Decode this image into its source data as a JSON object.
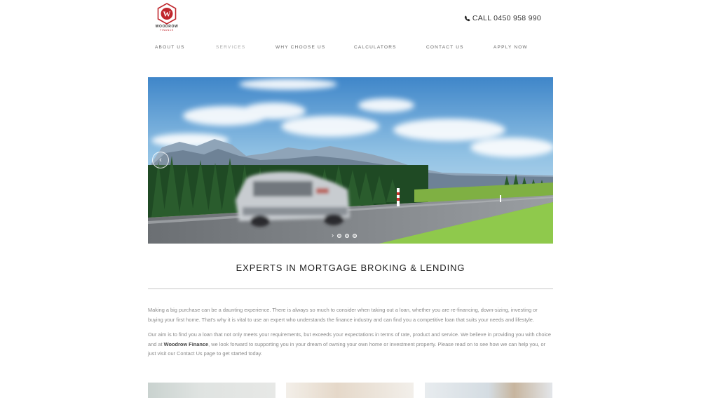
{
  "brand": {
    "name": "WOODROW",
    "sub": "FINANCE",
    "mark": "W",
    "color": "#c0272d"
  },
  "header": {
    "phone_text": "CALL 0450 958 990",
    "phone_icon": "phone-icon"
  },
  "nav": {
    "items": [
      {
        "label": "ABOUT US"
      },
      {
        "label": "SERVICES"
      },
      {
        "label": "WHY CHOOSE US"
      },
      {
        "label": "CALCULATORS"
      },
      {
        "label": "CONTACT US"
      },
      {
        "label": "APPLY NOW"
      }
    ]
  },
  "slider": {
    "prev_icon": "chevron-left-icon",
    "next_icon": "chevron-right-icon",
    "next_glyph": "›",
    "prev_glyph": "‹",
    "slides": 3
  },
  "main": {
    "heading": "EXPERTS IN MORTGAGE BROKING & LENDING",
    "paragraph1": "Making a big purchase can be a daunting experience. There is always so much to consider when taking out a loan, whether you are re-financing, down-sizing, investing or buying your first home. That's why it is vital to use an expert who understands the finance industry and can find you a competitive loan that suits your needs and lifestyle.",
    "paragraph2_before": "Our aim is to find you a loan that not only meets your requirements, but exceeds your expectations in terms of rate, product and service. We believe in providing you with choice and at ",
    "paragraph2_bold": "Woodrow Finance",
    "paragraph2_after": ", we look forward to supporting you in your dream of owning your own home or investment property. Please read on to see how we can help you, or just visit our Contact Us page to get started today."
  }
}
